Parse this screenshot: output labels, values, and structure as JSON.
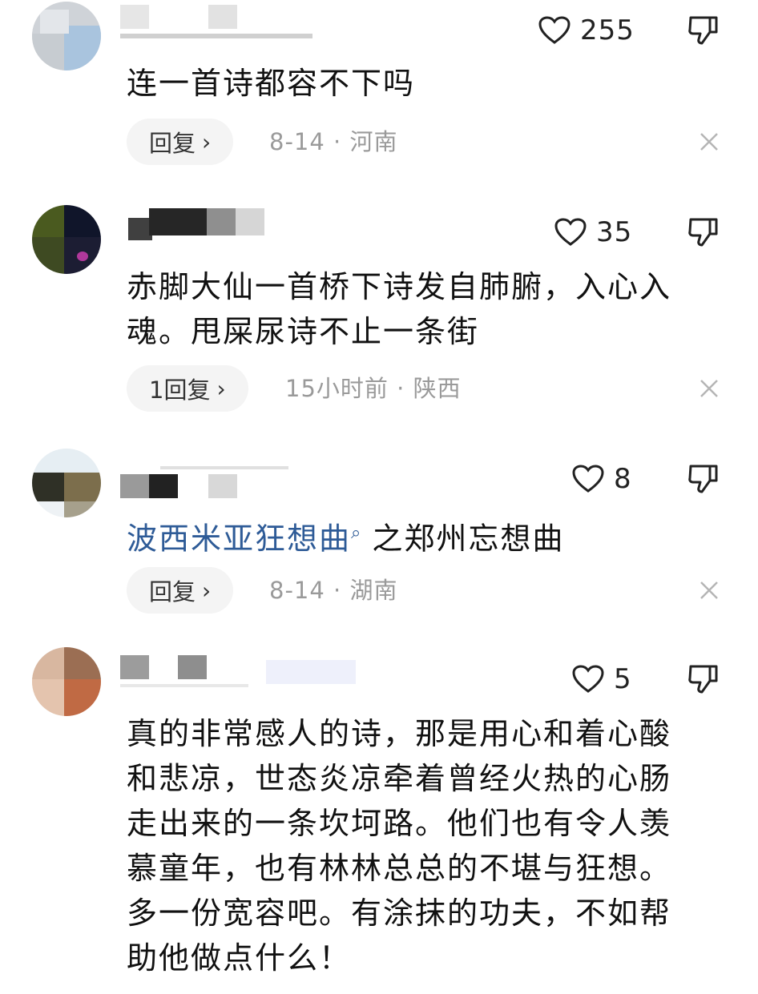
{
  "comments": [
    {
      "likes": "255",
      "text": "连一首诗都容不下吗",
      "reply_label": "回复",
      "date": "8-14",
      "location": "河南"
    },
    {
      "likes": "35",
      "text_line1": "赤脚大仙一首桥下诗发自肺腑，入心入",
      "text_line2": "魂。甩屎尿诗不止一条街",
      "reply_label": "1回复",
      "date": "15小时前",
      "location": "陕西"
    },
    {
      "likes": "8",
      "link_text": "波西米亚狂想曲",
      "text_rest": "之郑州忘想曲",
      "reply_label": "回复",
      "date": "8-14",
      "location": "湖南"
    },
    {
      "likes": "5",
      "lines": [
        "真的非常感人的诗，那是用心和着心酸",
        "和悲凉，世态炎凉牵着曾经火热的心肠",
        "走出来的一条坎坷路。他们也有令人羡",
        "慕童年，也有林林总总的不堪与狂想。",
        "多一份宽容吧。有涂抹的功夫，不如帮",
        "助他做点什么！"
      ]
    }
  ],
  "separator": "·",
  "chevron": "›",
  "icons": {
    "like": "heart-outline-icon",
    "dislike": "thumbs-down-outline-icon",
    "close": "close-icon",
    "search": "search-icon"
  }
}
